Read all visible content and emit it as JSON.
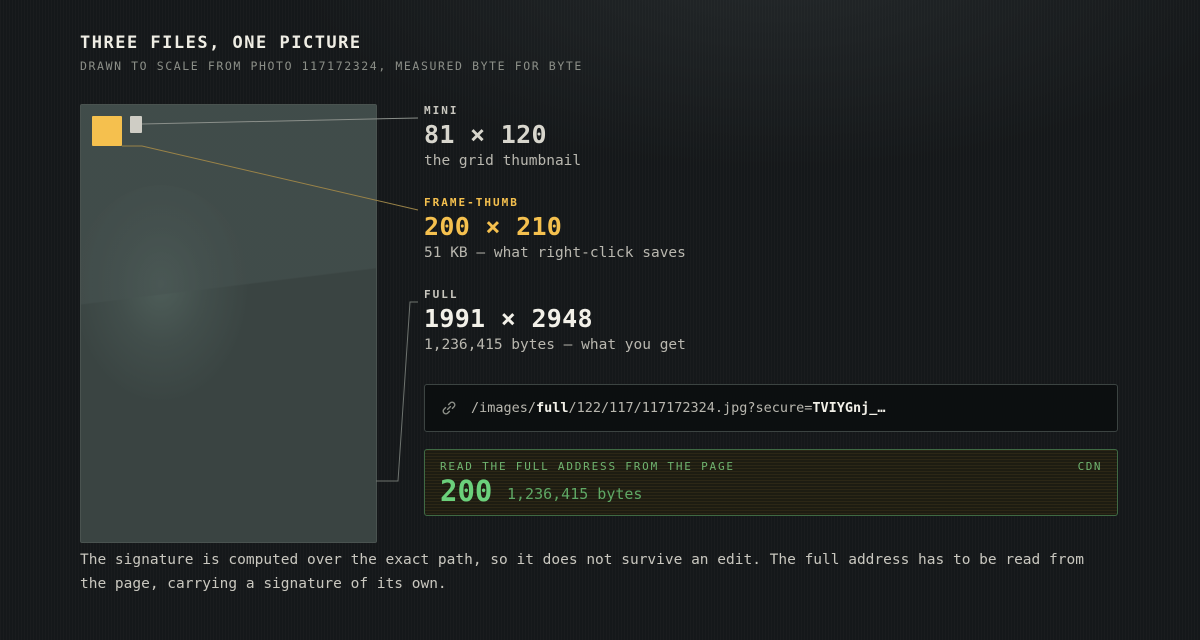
{
  "header": {
    "title": "THREE FILES, ONE PICTURE",
    "subtitle": "DRAWN TO SCALE FROM PHOTO 117172324, MEASURED BYTE FOR BYTE"
  },
  "tiers": [
    {
      "label": "MINI",
      "dims": "81 × 120",
      "note": "the grid thumbnail"
    },
    {
      "label": "FRAME-THUMB",
      "dims": "200 × 210",
      "note": "51 KB — what right-click saves"
    },
    {
      "label": "FULL",
      "dims": "1991 × 2948",
      "note": "1,236,415 bytes — what you get"
    }
  ],
  "url": {
    "icon": "link-icon",
    "prefix": "/images/",
    "segment": "full",
    "path": "/122/117/117172324.jpg?secure=",
    "token": "TVIYGnj_…"
  },
  "result": {
    "caption": "READ THE FULL ADDRESS FROM THE PAGE",
    "tag": "CDN",
    "status": "200",
    "bytes": "1,236,415 bytes"
  },
  "footnote": "The signature is computed over the exact path, so it does not survive an edit. The full address has to be read from the page, carrying a signature of its own.",
  "colors": {
    "accent": "#f5c04e",
    "success": "#6bd07b",
    "background": "#15181a"
  }
}
